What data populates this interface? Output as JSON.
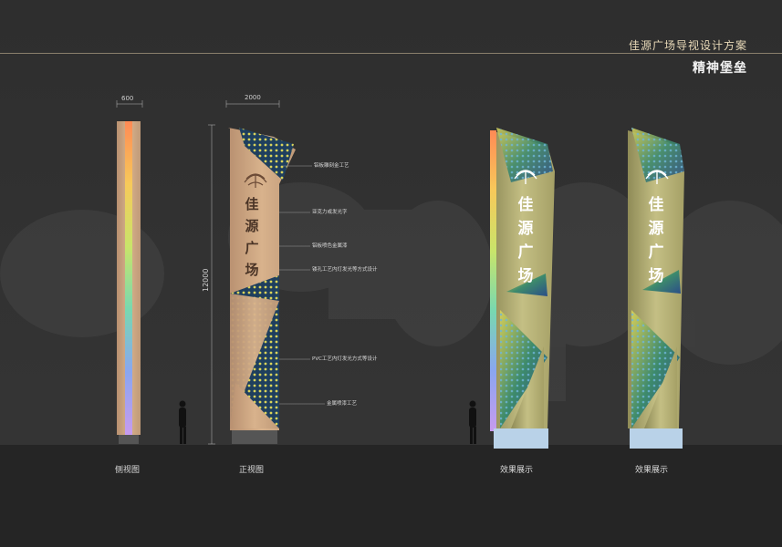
{
  "header": {
    "title": "佳源广场导视设计方案",
    "subtitle": "精神堡垒"
  },
  "dimensions": {
    "side_width": "600",
    "front_width": "2000",
    "height": "12000"
  },
  "sign": {
    "chars": [
      "佳",
      "源",
      "广",
      "场"
    ]
  },
  "callouts": [
    "铝板雕刻金工艺",
    "亚克力或发光字",
    "铝板喷色金属漆",
    "镂孔工艺内灯发光等方式设计",
    "PVC工艺内灯发光方式等设计",
    "金属喷漆工艺"
  ],
  "captions": {
    "side_view": "侧视图",
    "front_view": "正视图",
    "effect_1": "效果展示",
    "effect_2": "效果展示"
  },
  "colors": {
    "background": "#2b2b2b",
    "gold": "#c9a27a",
    "header_text": "#e8d9b8"
  }
}
